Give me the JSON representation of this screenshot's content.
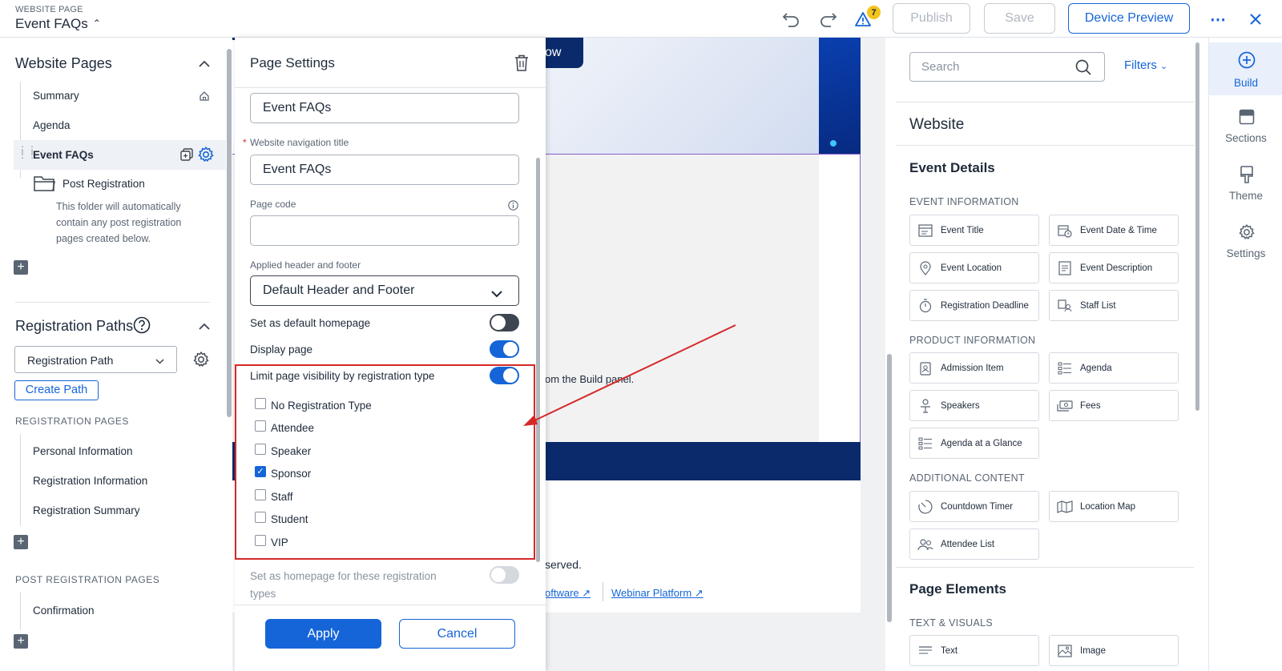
{
  "topbar": {
    "supertitle": "WEBSITE PAGE",
    "title": "Event FAQs",
    "warning_count": "7",
    "publish_label": "Publish",
    "save_label": "Save",
    "device_preview_label": "Device Preview"
  },
  "left_panel": {
    "website_pages_heading": "Website Pages",
    "pages": [
      {
        "label": "Summary"
      },
      {
        "label": "Agenda"
      },
      {
        "label": "Event FAQs"
      }
    ],
    "folder_label": "Post Registration",
    "folder_note": "This folder will automatically contain any post registration pages created below.",
    "registration_paths_heading": "Registration Paths",
    "path_select_value": "Registration Path",
    "create_path_label": "Create Path",
    "registration_pages_heading": "REGISTRATION PAGES",
    "registration_pages": [
      {
        "label": "Personal Information"
      },
      {
        "label": "Registration Information"
      },
      {
        "label": "Registration Summary"
      }
    ],
    "post_registration_heading": "POST REGISTRATION PAGES",
    "post_registration_pages": [
      {
        "label": "Confirmation"
      }
    ]
  },
  "page_settings": {
    "heading": "Page Settings",
    "page_name_value": "Event FAQs",
    "nav_title_label": "Website navigation title",
    "nav_title_value": "Event FAQs",
    "page_code_label": "Page code",
    "page_code_value": "",
    "header_footer_label": "Applied header and footer",
    "header_footer_value": "Default Header and Footer",
    "default_homepage_label": "Set as default homepage",
    "display_page_label": "Display page",
    "limit_visibility_label": "Limit page visibility by registration type",
    "registration_types": [
      {
        "label": "No Registration Type",
        "checked": false
      },
      {
        "label": "Attendee",
        "checked": false
      },
      {
        "label": "Speaker",
        "checked": false
      },
      {
        "label": "Sponsor",
        "checked": true
      },
      {
        "label": "Staff",
        "checked": false
      },
      {
        "label": "Student",
        "checked": false
      },
      {
        "label": "VIP",
        "checked": false
      }
    ],
    "homepage_for_types_label": "Set as homepage for these registration types",
    "apply_label": "Apply",
    "cancel_label": "Cancel"
  },
  "preview": {
    "button_fragment": "ow",
    "build_text_fragment": "om the Build panel.",
    "footer_fragment": "served.",
    "link_software": "oftware",
    "link_webinar": "Webinar Platform"
  },
  "build_panel": {
    "search_placeholder": "Search",
    "filters_label": "Filters",
    "website_heading": "Website",
    "event_details_heading": "Event Details",
    "event_information_heading": "EVENT INFORMATION",
    "event_information": [
      {
        "label": "Event Title",
        "icon": "title-icon"
      },
      {
        "label": "Event Date & Time",
        "icon": "calendar-clock-icon"
      },
      {
        "label": "Event Location",
        "icon": "pin-icon"
      },
      {
        "label": "Event Description",
        "icon": "description-icon"
      },
      {
        "label": "Registration Deadline",
        "icon": "stopwatch-icon"
      },
      {
        "label": "Staff List",
        "icon": "staff-icon"
      }
    ],
    "product_information_heading": "PRODUCT INFORMATION",
    "product_information": [
      {
        "label": "Admission Item",
        "icon": "badge-icon"
      },
      {
        "label": "Agenda",
        "icon": "list-icon"
      },
      {
        "label": "Speakers",
        "icon": "speaker-icon"
      },
      {
        "label": "Fees",
        "icon": "money-icon"
      },
      {
        "label": "Agenda at a Glance",
        "icon": "list-icon"
      }
    ],
    "additional_content_heading": "ADDITIONAL CONTENT",
    "additional_content": [
      {
        "label": "Countdown Timer",
        "icon": "timer-icon"
      },
      {
        "label": "Location Map",
        "icon": "map-icon"
      },
      {
        "label": "Attendee List",
        "icon": "people-icon"
      }
    ],
    "page_elements_heading": "Page Elements",
    "text_visuals_heading": "TEXT & VISUALS",
    "text_visuals": [
      {
        "label": "Text",
        "icon": "text-icon"
      },
      {
        "label": "Image",
        "icon": "image-icon"
      }
    ]
  },
  "rail": {
    "build_label": "Build",
    "sections_label": "Sections",
    "theme_label": "Theme",
    "settings_label": "Settings"
  },
  "colors": {
    "accent": "#1565d8",
    "annotation": "#d62828",
    "banner": "#0a2a6b"
  }
}
